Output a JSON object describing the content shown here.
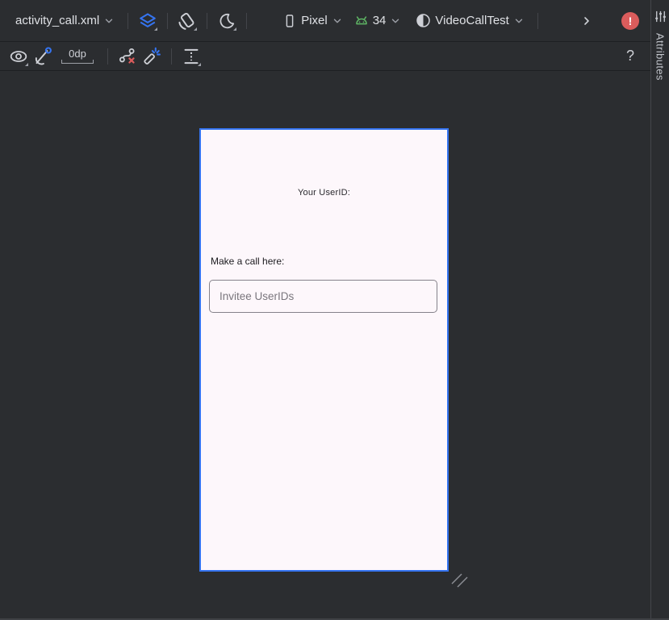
{
  "toolbar": {
    "file_selector_label": "activity_call.xml",
    "device_selector_label": "Pixel",
    "api_selector_label": "34",
    "theme_selector_label": "VideoCallTest",
    "error_badge_glyph": "!"
  },
  "actions_bar": {
    "default_margin_value": "0dp",
    "help_glyph": "?"
  },
  "right_panel": {
    "tab_label": "Attributes"
  },
  "preview": {
    "userid_label": "Your UserID:",
    "make_call_label": "Make a call here:",
    "invitee_placeholder": "Invitee UserIDs"
  },
  "colors": {
    "accent_blue": "#3574f0",
    "android_green": "#5fb865",
    "error_red": "#db5c5c",
    "panel_bg": "#2b2d30",
    "screen_bg": "#fdf7fb"
  }
}
